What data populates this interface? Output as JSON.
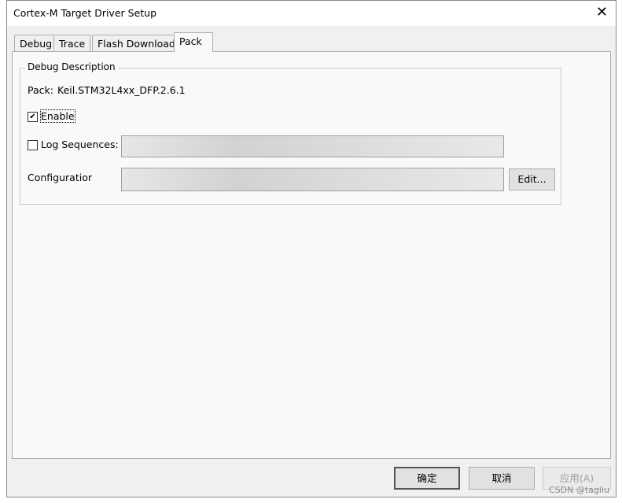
{
  "window": {
    "title": "Cortex-M Target Driver Setup"
  },
  "tabs": [
    {
      "label": "Debug"
    },
    {
      "label": "Trace"
    },
    {
      "label": "Flash Download"
    },
    {
      "label": "Pack",
      "active": true
    }
  ],
  "group": {
    "title": "Debug Description",
    "pack_label": "Pack:",
    "pack_value": "Keil.STM32L4xx_DFP.2.6.1",
    "enable_label": "Enable",
    "enable_checked": true,
    "log_label": "Log Sequences:",
    "log_checked": false,
    "config_label": "Configuratior",
    "edit_label": "Edit..."
  },
  "footer": {
    "ok": "确定",
    "cancel": "取消",
    "apply": "应用(A)"
  },
  "watermark": "CSDN @tagliu"
}
